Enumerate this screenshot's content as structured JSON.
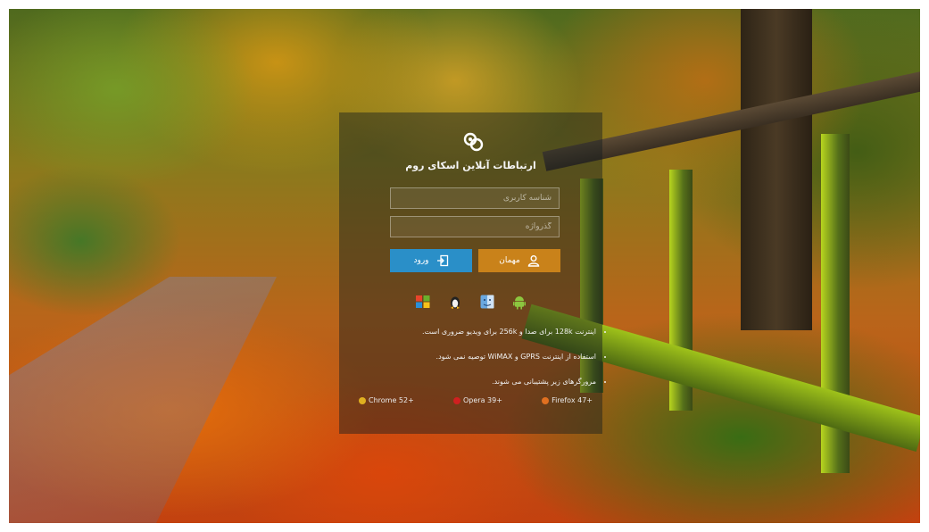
{
  "login": {
    "title": "ارتباطات آنلاین اسکای روم",
    "username_placeholder": "شناسه کاربری",
    "password_placeholder": "گذرواژه",
    "guest_label": "مهمان",
    "login_label": "ورود"
  },
  "platforms": [
    "windows-icon",
    "linux-icon",
    "mac-icon",
    "android-icon"
  ],
  "notes": [
    "اینترنت 128k برای صدا و 256k برای ویدیو ضروری است.",
    "استفاده از اینترنت GPRS و WiMAX توصیه نمی شود.",
    "مرورگرهای زیر پشتیبانی می شوند."
  ],
  "browsers": [
    {
      "name": "Chrome 52+",
      "color": "#e0b020"
    },
    {
      "name": "Opera 39+",
      "color": "#d02020"
    },
    {
      "name": "Firefox 47+",
      "color": "#e07020"
    }
  ],
  "colors": {
    "guest_button": "#c9821a",
    "login_button": "#2a8fc8",
    "panel": "rgba(20,28,30,0.45)"
  }
}
